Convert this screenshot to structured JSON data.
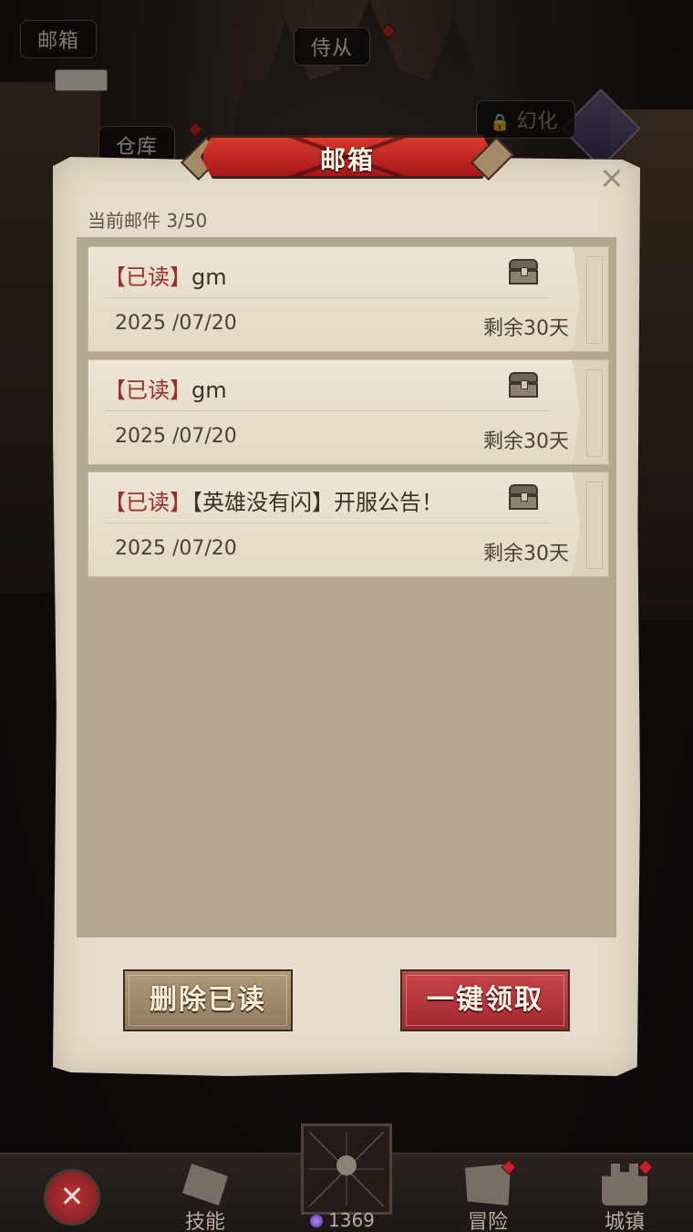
{
  "scene": {
    "tags": {
      "mail": "邮箱",
      "servant": "侍从",
      "warehouse": "仓库",
      "locked_feature": "幻化"
    }
  },
  "mail_panel": {
    "title": "邮箱",
    "close_symbol": "×",
    "count_label": "当前邮件 3/50",
    "items": [
      {
        "read_tag": "【已读】",
        "subject": "gm",
        "date": "2025 /07/20",
        "remain": "剩余30天"
      },
      {
        "read_tag": "【已读】",
        "subject": "gm",
        "date": "2025 /07/20",
        "remain": "剩余30天"
      },
      {
        "read_tag": "【已读】",
        "subject": "【英雄没有闪】开服公告！",
        "date": "2025 /07/20",
        "remain": "剩余30天"
      }
    ],
    "buttons": {
      "delete_read": "删除已读",
      "claim_all": "一键领取"
    }
  },
  "bottom_nav": {
    "cancel_symbol": "✕",
    "skill": "技能",
    "adventure": "冒险",
    "town": "城镇",
    "gems": "1369"
  },
  "colors": {
    "panel": "#e6dccb",
    "read_tag": "#9b2f2a",
    "banner_red": "#c4232a",
    "claim_button": "#a12830",
    "delete_button": "#8f7a5c"
  }
}
